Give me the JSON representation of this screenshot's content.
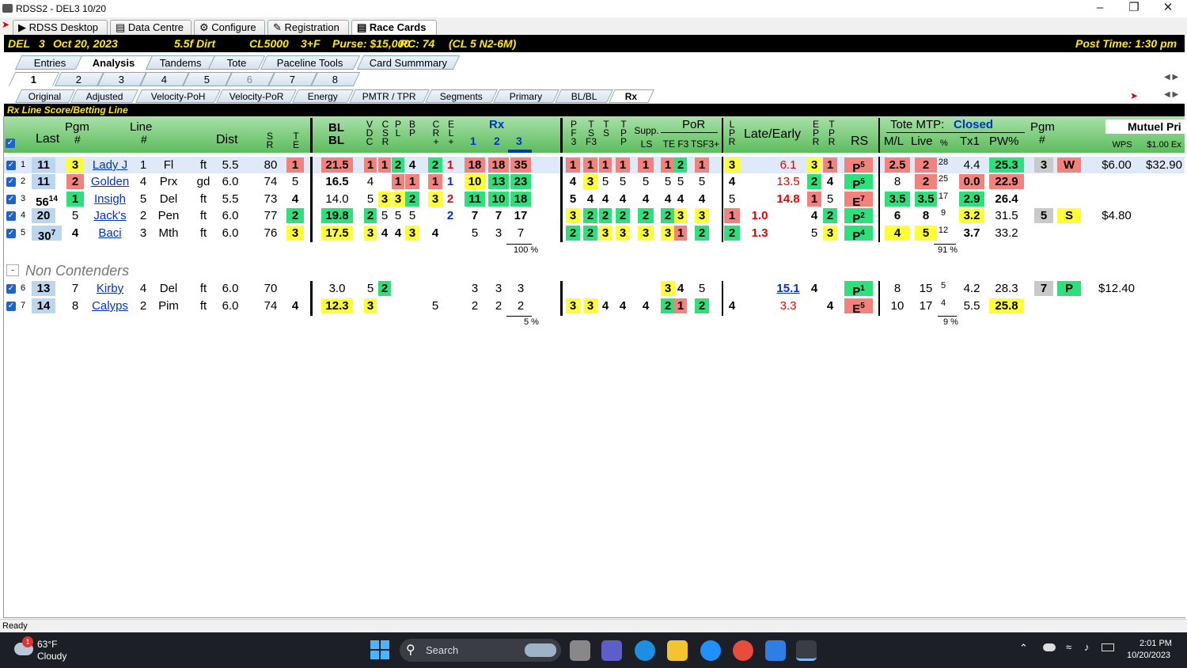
{
  "window": {
    "title": "RDSS2 - DEL3  10/20"
  },
  "app_tabs": [
    "RDSS Desktop",
    "Data Centre",
    "Configure",
    "Registration",
    "Race Cards"
  ],
  "race_header": {
    "track": "DEL",
    "race": "3",
    "date": "Oct 20, 2023",
    "dist_surface": "5.5f Dirt",
    "class": "CL5000",
    "age": "3+F",
    "purse": "Purse: $15,000",
    "rc": "RC: 74",
    "cl": "(CL 5 N2-6M)",
    "post_time": "Post Time: 1:30 pm"
  },
  "tabs_main": [
    "Entries",
    "Analysis",
    "Tandems",
    "Tote",
    "Paceline Tools",
    "Card Summmary"
  ],
  "tabs_races": [
    "1",
    "2",
    "3",
    "4",
    "5",
    "6",
    "7",
    "8"
  ],
  "tabs_views": [
    "Original",
    "Adjusted",
    "Velocity-PoH",
    "Velocity-PoR",
    "Energy",
    "PMTR / TPR",
    "Segments",
    "Primary",
    "BL/BL",
    "Rx"
  ],
  "section_title": "Rx Line Score/Betting Line",
  "headers": {
    "last": "Last",
    "pgm": "Pgm",
    "pgm_hash": "#",
    "line": "Line",
    "line_hash": "#",
    "dist": "Dist",
    "sr": "S\nR",
    "te": "T\nE",
    "blbl": "BL\nBL",
    "vdc": "V\nD\nC",
    "csr": "C\nS\nR",
    "pl": "P\nL",
    "bp": "B\nP",
    "cr": "C\nR\n+",
    "el": "E\nL\n+",
    "rx": "Rx",
    "rx1": "1",
    "rx2": "2",
    "rx3": "3",
    "pf3": "P\nF\n3",
    "tsf3": "T\nS\nF3",
    "ts": "T\nS",
    "tpp": "T\nP\nP",
    "supp": "Supp.",
    "ls": "LS",
    "por": "PoR",
    "te_f3": "TE F3",
    "tsf3p": "TSF3+",
    "lpr": "L\nP\nR",
    "late_early": "Late/Early",
    "epr": "E\nP\nR",
    "tpr": "T\nP\nR",
    "rs": "RS",
    "tote_mtp": "Tote MTP:",
    "closed": "Closed",
    "ml": "M/L",
    "live": "Live",
    "pct": "%",
    "tx1": "Tx1",
    "pw": "PW%",
    "pgm2": "Pgm",
    "pgm2_hash": "#",
    "mutuel": "Mutuel Pri",
    "wps": "WPS",
    "ex": "$1.00 Ex"
  },
  "rows": [
    {
      "n": "1",
      "last": "11",
      "pgm": "3",
      "name": "Lady J",
      "line": "1",
      "trk": "Fl",
      "cond": "ft",
      "dist": "5.5",
      "sr": "80",
      "te": "1",
      "blbl": "21.5",
      "vdc": "1",
      "csr": "1",
      "pl": "2",
      "bp": "4",
      "cr": "2",
      "el": "1",
      "rx1": "18",
      "rx2": "18",
      "rx3": "35",
      "pf3": "1",
      "tsf3": "1",
      "ts": "1",
      "tpp": "1",
      "ls": "1",
      "tef3": "1",
      "f3": "2",
      "tsf3p": "1",
      "lpr": "3",
      "late": "",
      "early": "6.1",
      "epr": "3",
      "tpr": "1",
      "rs": "P",
      "rs_sup": "5",
      "ml": "2.5",
      "live": "2",
      "pct": "28",
      "tx1": "4.4",
      "pw": "25.3",
      "pgm2": "3",
      "fin": "W",
      "wps": "$6.00",
      "ex": "$32.90"
    },
    {
      "n": "2",
      "last": "11",
      "pgm": "2",
      "name": "Golden",
      "line": "4",
      "trk": "Prx",
      "cond": "gd",
      "dist": "6.0",
      "sr": "74",
      "te": "5",
      "blbl": "16.5",
      "vdc": "4",
      "csr": "",
      "pl": "1",
      "bp": "1",
      "cr": "1",
      "el": "1",
      "rx1": "10",
      "rx2": "13",
      "rx3": "23",
      "pf3": "4",
      "tsf3": "3",
      "ts": "5",
      "tpp": "5",
      "ls": "5",
      "tef3": "5",
      "f3": "5",
      "tsf3p": "5",
      "lpr": "4",
      "late": "",
      "early": "13.5",
      "epr": "2",
      "tpr": "4",
      "rs": "P",
      "rs_sup": "5",
      "ml": "8",
      "live": "2",
      "pct": "25",
      "tx1": "0.0",
      "pw": "22.9",
      "pgm2": "",
      "fin": "",
      "wps": "",
      "ex": ""
    },
    {
      "n": "3",
      "last": "56",
      "last_sup": "14",
      "pgm": "1",
      "name": "Insigh",
      "line": "5",
      "trk": "Del",
      "cond": "ft",
      "dist": "5.5",
      "sr": "73",
      "te": "4",
      "blbl": "14.0",
      "vdc": "5",
      "csr": "3",
      "pl": "3",
      "bp": "2",
      "cr": "3",
      "el": "2",
      "rx1": "11",
      "rx2": "10",
      "rx3": "18",
      "pf3": "5",
      "tsf3": "4",
      "ts": "4",
      "tpp": "4",
      "ls": "4",
      "tef3": "4",
      "f3": "4",
      "tsf3p": "4",
      "lpr": "5",
      "late": "",
      "early": "14.8",
      "epr": "1",
      "tpr": "5",
      "rs": "E",
      "rs_sup": "7",
      "ml": "3.5",
      "live": "3.5",
      "pct": "17",
      "tx1": "2.9",
      "pw": "26.4",
      "pgm2": "",
      "fin": "",
      "wps": "",
      "ex": ""
    },
    {
      "n": "4",
      "last": "20",
      "pgm": "5",
      "name": "Jack's",
      "line": "2",
      "trk": "Pen",
      "cond": "ft",
      "dist": "6.0",
      "sr": "77",
      "te": "2",
      "blbl": "19.8",
      "vdc": "2",
      "csr": "5",
      "pl": "5",
      "bp": "5",
      "cr": "",
      "el": "2",
      "rx1": "7",
      "rx2": "7",
      "rx3": "17",
      "pf3": "3",
      "tsf3": "2",
      "ts": "2",
      "tpp": "2",
      "ls": "2",
      "tef3": "2",
      "f3": "3",
      "tsf3p": "3",
      "lpr": "1",
      "late": "1.0",
      "early": "",
      "epr": "4",
      "tpr": "2",
      "rs": "P",
      "rs_sup": "2",
      "ml": "6",
      "live": "8",
      "pct": "9",
      "tx1": "3.2",
      "pw": "31.5",
      "pgm2": "5",
      "fin": "S",
      "wps": "$4.80",
      "ex": ""
    },
    {
      "n": "5",
      "last": "30",
      "last_sup": "7",
      "pgm": "4",
      "name": "Baci",
      "line": "3",
      "trk": "Mth",
      "cond": "ft",
      "dist": "6.0",
      "sr": "76",
      "te": "3",
      "blbl": "17.5",
      "vdc": "3",
      "csr": "4",
      "pl": "4",
      "bp": "3",
      "cr": "4",
      "el": "",
      "rx1": "5",
      "rx2": "3",
      "rx3": "7",
      "pf3": "2",
      "tsf3": "2",
      "ts": "3",
      "tpp": "3",
      "ls": "3",
      "tef3": "3",
      "f3": "1",
      "tsf3p": "2",
      "lpr": "2",
      "late": "1.3",
      "early": "",
      "epr": "5",
      "tpr": "3",
      "rs": "P",
      "rs_sup": "4",
      "ml": "4",
      "live": "5",
      "pct": "12",
      "tx1": "3.7",
      "pw": "33.2",
      "pgm2": "",
      "fin": "",
      "wps": "",
      "ex": ""
    }
  ],
  "rx_total_1": "100 %",
  "pct_total_1": "91 %",
  "non_contenders_label": "Non Contenders",
  "collapse_symbol": "-",
  "nc_rows": [
    {
      "n": "6",
      "last": "13",
      "pgm": "7",
      "name": "Kirby",
      "line": "4",
      "trk": "Del",
      "cond": "ft",
      "dist": "6.0",
      "sr": "70",
      "te": "",
      "blbl": "3.0",
      "vdc": "5",
      "csr": "2",
      "rx1": "3",
      "rx2": "3",
      "rx3": "3",
      "tef3": "3",
      "f3": "4",
      "tsf3p": "5",
      "early": "15.1",
      "epr": "4",
      "rs": "P",
      "rs_sup": "1",
      "ml": "8",
      "live": "15",
      "pct": "5",
      "tx1": "4.2",
      "pw": "28.3",
      "pgm2": "7",
      "fin": "P",
      "wps": "$12.40"
    },
    {
      "n": "7",
      "last": "14",
      "pgm": "8",
      "name": "Calyps",
      "line": "2",
      "trk": "Pim",
      "cond": "ft",
      "dist": "6.0",
      "sr": "74",
      "te": "4",
      "blbl": "12.3",
      "vdc": "3",
      "cr": "5",
      "rx1": "2",
      "rx2": "2",
      "rx3": "2",
      "pf3": "3",
      "tsf3": "3",
      "ts": "4",
      "tpp": "4",
      "ls": "4",
      "tef3": "2",
      "f3": "1",
      "tsf3p": "2",
      "lpr": "4",
      "early": "3.3",
      "tpr": "4",
      "rs": "E",
      "rs_sup": "5",
      "ml": "10",
      "live": "17",
      "pct": "4",
      "tx1": "5.5",
      "pw": "25.8"
    }
  ],
  "rx_total_2": "5 %",
  "pct_total_2": "9 %",
  "status": "Ready",
  "taskbar": {
    "temp": "63°F",
    "weather": "Cloudy",
    "badge": "1",
    "search": "Search",
    "time": "2:01 PM",
    "date": "10/20/2023"
  }
}
